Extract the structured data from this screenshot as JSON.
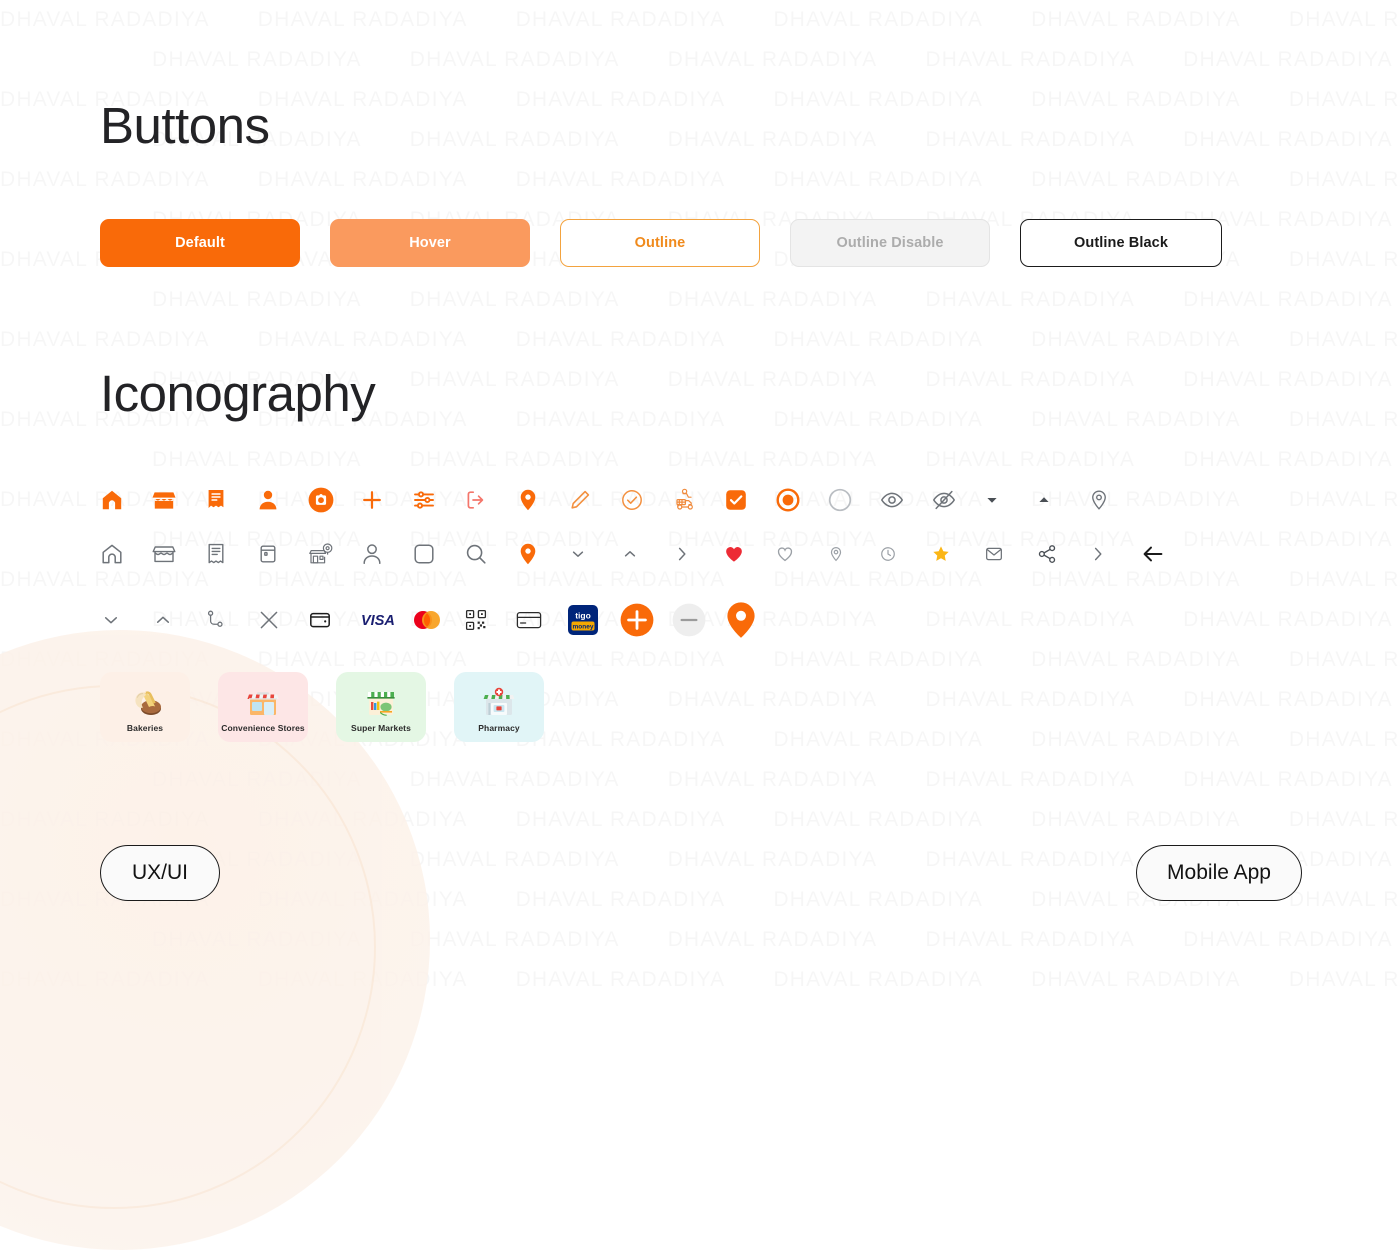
{
  "watermark": {
    "text": "DHAVAL RADADIYA",
    "repeat_per_row": 8,
    "rows": 26
  },
  "sections": {
    "buttons_title": "Buttons",
    "iconography_title": "Iconography"
  },
  "colors": {
    "primary_orange": "#F96A09",
    "hover_orange": "#FA9A5E",
    "outline_orange": "#F3A33F",
    "disabled_gray": "#ACACAC",
    "disabled_bg": "#F3F3F3",
    "black": "#1B1B1B",
    "icon_gray": "#6E7379",
    "heart_red": "#ED2B35",
    "star_yellow": "#FBB616",
    "visa_blue": "#1A1F71",
    "mastercard_red": "#EB001B",
    "mastercard_yellow": "#F79E1B",
    "tigo_blue": "#00257A"
  },
  "buttons": [
    {
      "label": "Default",
      "state": "default",
      "variant": "solid"
    },
    {
      "label": "Hover",
      "state": "hover",
      "variant": "solid"
    },
    {
      "label": "Outline",
      "state": "default",
      "variant": "outline"
    },
    {
      "label": "Outline Disable",
      "state": "disabled",
      "variant": "outline"
    },
    {
      "label": "Outline Black",
      "state": "default",
      "variant": "outline-black"
    }
  ],
  "icons": {
    "row1": [
      {
        "name": "home-filled-icon",
        "color": "#F96A09"
      },
      {
        "name": "store-filled-icon",
        "color": "#F96A09"
      },
      {
        "name": "receipt-filled-icon",
        "color": "#F96A09"
      },
      {
        "name": "person-filled-icon",
        "color": "#F96A09"
      },
      {
        "name": "camera-circle-icon",
        "color": "#F96A09"
      },
      {
        "name": "plus-icon",
        "color": "#F96A09"
      },
      {
        "name": "filter-sliders-icon",
        "color": "#F96A09"
      },
      {
        "name": "logout-icon",
        "color": "#F4766B"
      },
      {
        "name": "location-pin-filled-icon",
        "color": "#F96A09"
      },
      {
        "name": "pencil-edit-icon",
        "color": "#F3903F"
      },
      {
        "name": "check-circle-icon",
        "color": "#F3903F"
      },
      {
        "name": "delivery-scooter-icon",
        "color": "#F08A3C"
      },
      {
        "name": "checkbox-checked-icon",
        "color": "#F96A09"
      },
      {
        "name": "radio-selected-icon",
        "color": "#F96A09"
      },
      {
        "name": "radio-unselected-icon",
        "color": "#B9BDC2"
      },
      {
        "name": "eye-icon",
        "color": "#6E7379"
      },
      {
        "name": "eye-off-icon",
        "color": "#6E7379"
      },
      {
        "name": "triangle-down-icon",
        "color": "#4A4F55"
      },
      {
        "name": "triangle-up-icon",
        "color": "#4A4F55"
      },
      {
        "name": "location-pin-outline-icon",
        "color": "#6E7379"
      }
    ],
    "row2": [
      {
        "name": "home-outline-icon",
        "color": "#6E7379"
      },
      {
        "name": "store-outline-icon",
        "color": "#6E7379"
      },
      {
        "name": "receipt-outline-icon",
        "color": "#6E7379"
      },
      {
        "name": "wallet-outline-icon",
        "color": "#6E7379"
      },
      {
        "name": "store-pin-outline-icon",
        "color": "#6E7379"
      },
      {
        "name": "person-outline-icon",
        "color": "#6E7379"
      },
      {
        "name": "checkbox-unchecked-icon",
        "color": "#6E7379"
      },
      {
        "name": "search-icon",
        "color": "#6E7379"
      },
      {
        "name": "location-pin-filled-icon",
        "color": "#F96A09"
      },
      {
        "name": "chevron-down-icon",
        "color": "#6E7379"
      },
      {
        "name": "chevron-up-icon",
        "color": "#6E7379"
      },
      {
        "name": "chevron-right-icon",
        "color": "#6E7379"
      },
      {
        "name": "heart-filled-icon",
        "color": "#ED2B35"
      },
      {
        "name": "heart-outline-icon",
        "color": "#9BA0A6"
      },
      {
        "name": "pin-small-outline-icon",
        "color": "#9BA0A6"
      },
      {
        "name": "clock-icon",
        "color": "#9BA0A6"
      },
      {
        "name": "star-filled-icon",
        "color": "#FBB616"
      },
      {
        "name": "envelope-icon",
        "color": "#6E7379"
      },
      {
        "name": "share-icon",
        "color": "#4A4F55"
      },
      {
        "name": "chevron-right-thin-icon",
        "color": "#6E7379"
      },
      {
        "name": "arrow-left-icon",
        "color": "#1B1B1B"
      }
    ],
    "row3": [
      {
        "name": "chevron-down-icon",
        "color": "#6E7379"
      },
      {
        "name": "chevron-up-icon",
        "color": "#6E7379"
      },
      {
        "name": "route-path-icon",
        "color": "#6E7379"
      },
      {
        "name": "close-x-icon",
        "color": "#6E7379"
      },
      {
        "name": "wallet-icon",
        "color": "#1B1B1B"
      },
      {
        "name": "visa-logo-icon",
        "color": "#1A1F71",
        "label": "VISA"
      },
      {
        "name": "mastercard-logo-icon",
        "color": "#EB001B"
      },
      {
        "name": "qr-code-icon",
        "color": "#2B2B2B"
      },
      {
        "name": "credit-card-icon",
        "color": "#2B2B2B"
      },
      {
        "name": "tigo-money-logo-icon",
        "color": "#00257A",
        "label_top": "tigo",
        "label_bottom": "money"
      },
      {
        "name": "plus-circle-filled-icon",
        "color": "#F96A09"
      },
      {
        "name": "minus-circle-icon",
        "color": "#EDEDED"
      },
      {
        "name": "location-pin-large-icon",
        "color": "#F96A09"
      }
    ]
  },
  "category_cards": [
    {
      "label": "Bakeries",
      "bg": "#FDF0E7",
      "art": "bakery-art"
    },
    {
      "label": "Convenience Stores",
      "bg": "#FDE6E6",
      "art": "convenience-store-art"
    },
    {
      "label": "Super Markets",
      "bg": "#E4F7E4",
      "art": "supermarket-art"
    },
    {
      "label": "Pharmacy",
      "bg": "#E1F5F7",
      "art": "pharmacy-art"
    }
  ],
  "footer": {
    "left_pill": "UX/UI",
    "right_pill": "Mobile App"
  }
}
